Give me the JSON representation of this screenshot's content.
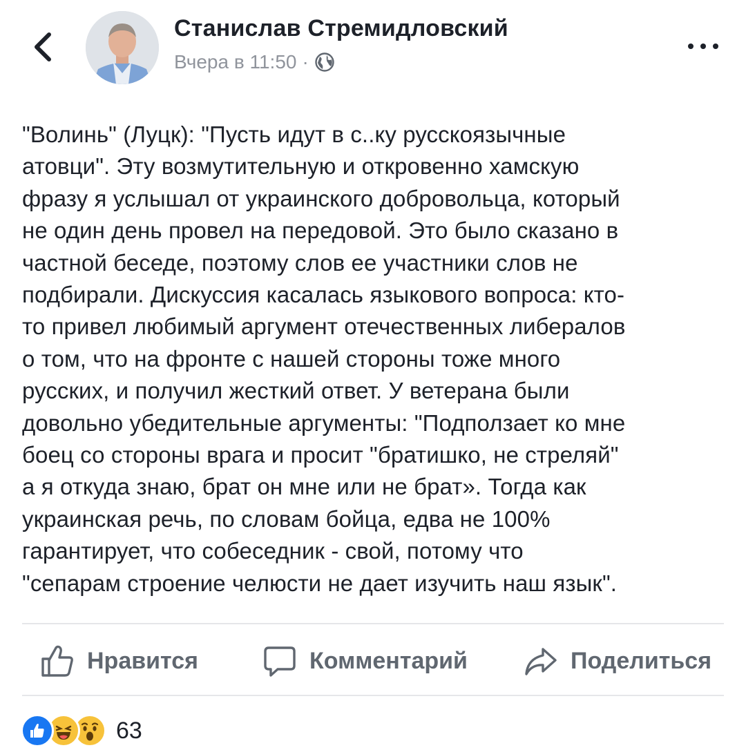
{
  "header": {
    "author_name": "Станислав Стремидловский",
    "time": "Вчера в 11:50",
    "separator": "·",
    "privacy_icon": "globe-icon",
    "back_icon": "chevron-left-icon",
    "more_icon": "more-horizontal-icon"
  },
  "post": {
    "lines": [
      "\"Волинь\" (Луцк): \"Пусть идут в с..ку русскоязычные",
      "атовци\". Эту возмутительную и откровенно хамскую",
      "фразу я услышал от украинского добровольца, который",
      "не один день провел на передовой. Это было сказано в",
      "частной беседе, поэтому слов ее участники слов не",
      "подбирали. Дискуссия касалась языкового вопроса: кто-",
      "то привел любимый аргумент отечественных либералов",
      "о том, что на фронте с нашей стороны тоже много",
      "русских, и получил жесткий ответ. У ветерана были",
      "довольно убедительные аргументы: \"Подползает ко мне",
      "боец со стороны врага и просит \"братишко, не стреляй\"",
      "а я откуда знаю, брат он мне или не брат». Тогда как",
      "украинская речь, по словам бойца, едва не 100%",
      "гарантирует, что собеседник - свой, потому что",
      "\"сепарам строение челюсти не дает изучить наш язык\"."
    ]
  },
  "actions": {
    "like": "Нравится",
    "comment": "Комментарий",
    "share": "Поделиться"
  },
  "reactions": {
    "icons": [
      "like-reaction-icon",
      "haha-reaction-icon",
      "wow-reaction-icon"
    ],
    "count": "63"
  },
  "colors": {
    "text": "#1d2129",
    "secondary": "#90949c",
    "action": "#606770",
    "divider": "#e5e6e9",
    "like_blue": "#1877f2",
    "emoji_yellow": "#f7c23a"
  }
}
